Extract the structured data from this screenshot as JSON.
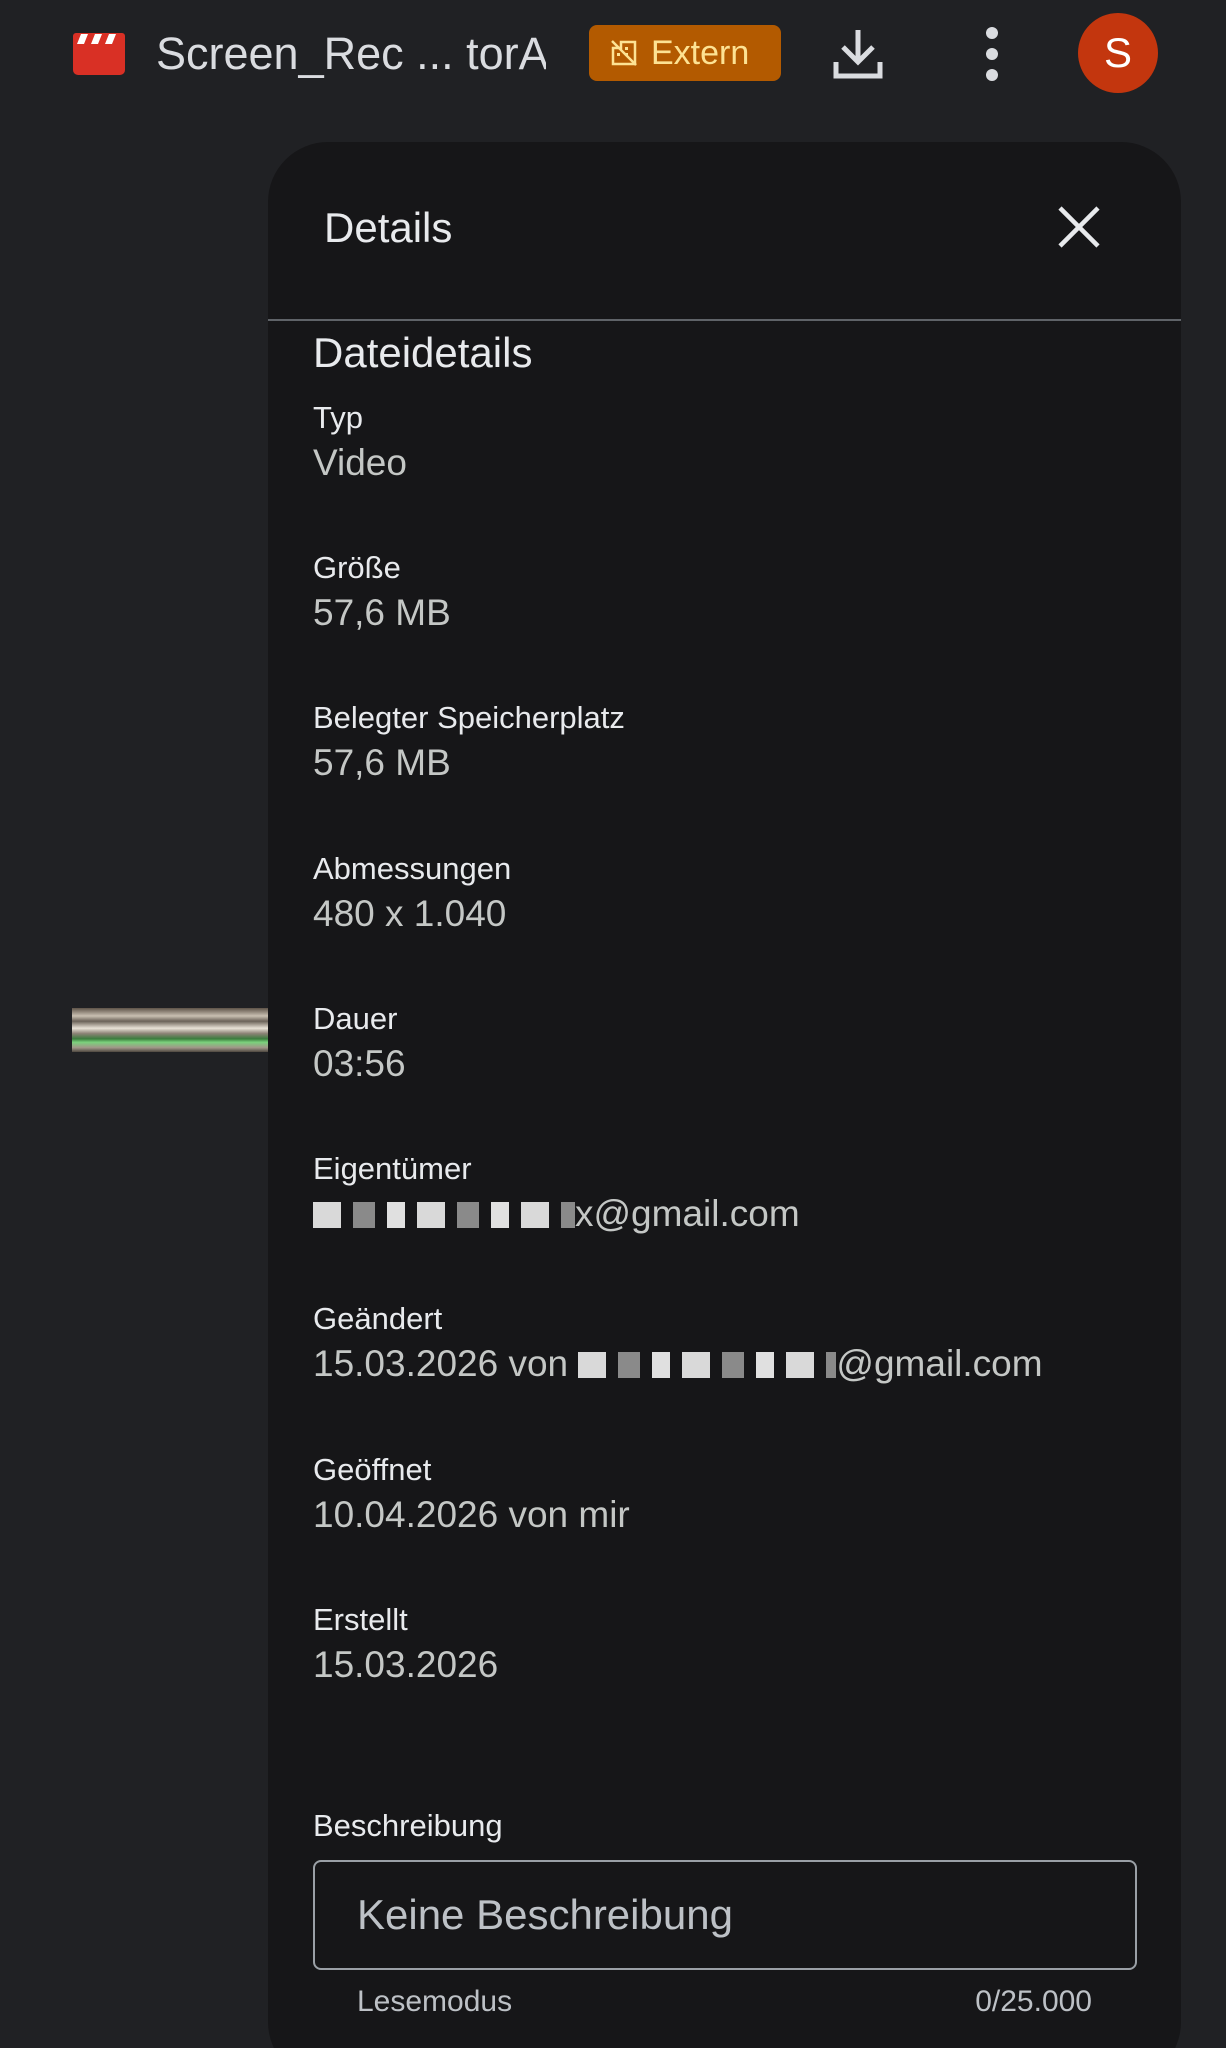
{
  "header": {
    "file_icon": "video-file-icon",
    "file_title": "Screen_Rec ... torA",
    "badge_label": "Extern",
    "badge_icon": "external-domain-icon",
    "download_icon": "download-icon",
    "more_icon": "more-vert-icon",
    "avatar_initial": "S",
    "colors": {
      "file_icon": "#d93025",
      "badge_bg": "#b35a00",
      "badge_text": "#fde293",
      "avatar_bg": "#c3360e"
    }
  },
  "panel": {
    "title": "Details",
    "close_icon": "close-icon",
    "section_heading": "Dateidetails",
    "details": [
      {
        "label": "Typ",
        "value": "Video"
      },
      {
        "label": "Größe",
        "value": "57,6 MB"
      },
      {
        "label": "Belegter Speicherplatz",
        "value": "57,6 MB"
      },
      {
        "label": "Abmessungen",
        "value": "480 x 1.040"
      },
      {
        "label": "Dauer",
        "value": "03:56"
      },
      {
        "label": "Eigentümer",
        "value": "x@gmail.com"
      },
      {
        "label": "Geändert",
        "value_prefix": "15.03.2026 von",
        "value": "@gmail.com"
      },
      {
        "label": "Geöffnet",
        "value": "10.04.2026 von mir"
      },
      {
        "label": "Erstellt",
        "value": "15.03.2026"
      }
    ],
    "description": {
      "label": "Beschreibung",
      "placeholder": "Keine Beschreibung",
      "value": "",
      "helper_left": "Lesemodus",
      "helper_right": "0/25.000"
    }
  }
}
